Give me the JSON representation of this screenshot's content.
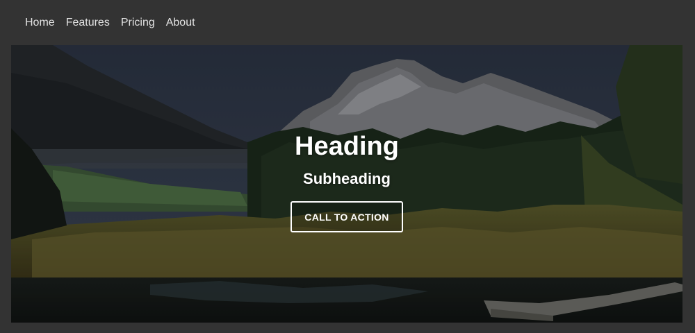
{
  "nav": {
    "items": [
      {
        "label": "Home"
      },
      {
        "label": "Features"
      },
      {
        "label": "Pricing"
      },
      {
        "label": "About"
      }
    ]
  },
  "hero": {
    "heading": "Heading",
    "subheading": "Subheading",
    "cta_label": "CALL TO ACTION",
    "background_image": "mountain-lake-landscape"
  },
  "colors": {
    "page_background": "#333333",
    "nav_text": "#e2e2e2",
    "hero_text": "#ffffff"
  }
}
